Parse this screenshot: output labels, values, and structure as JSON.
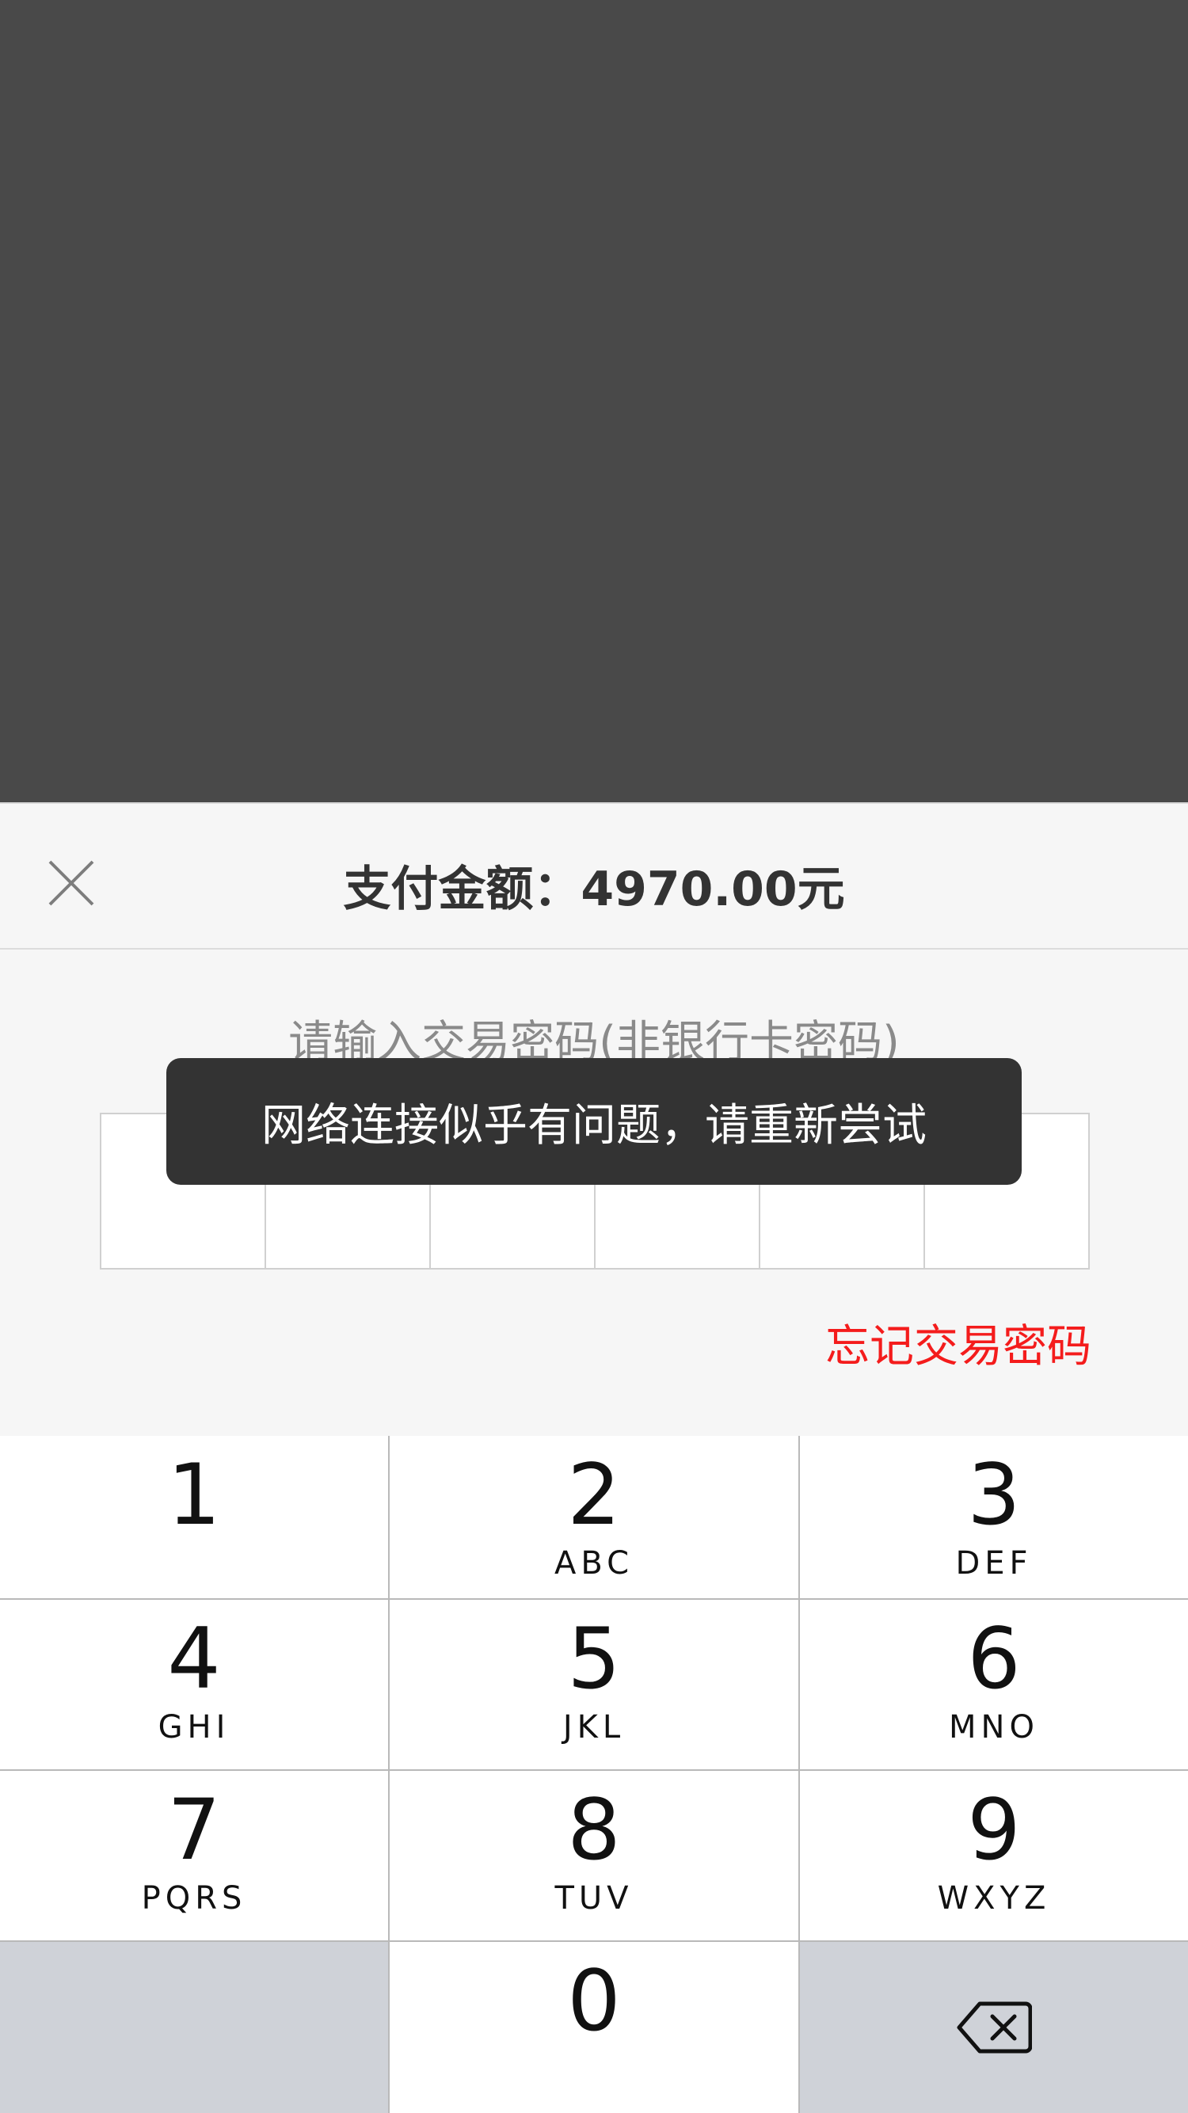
{
  "payment": {
    "amount_label": "支付金额：",
    "amount_value": "4970.00元",
    "prompt": "请输入交易密码(非银行卡密码)",
    "forgot_password": "忘记交易密码",
    "pin_length": 6
  },
  "toast": {
    "message": "网络连接似乎有问题，请重新尝试"
  },
  "keypad": {
    "keys": [
      {
        "digit": "1",
        "letters": ""
      },
      {
        "digit": "2",
        "letters": "ABC"
      },
      {
        "digit": "3",
        "letters": "DEF"
      },
      {
        "digit": "4",
        "letters": "GHI"
      },
      {
        "digit": "5",
        "letters": "JKL"
      },
      {
        "digit": "6",
        "letters": "MNO"
      },
      {
        "digit": "7",
        "letters": "PQRS"
      },
      {
        "digit": "8",
        "letters": "TUV"
      },
      {
        "digit": "9",
        "letters": "WXYZ"
      },
      {
        "digit": "0",
        "letters": ""
      }
    ],
    "backspace_icon": "backspace-icon"
  },
  "colors": {
    "overlay": "#494949",
    "accent_red": "#f41c1c",
    "toast_bg": "#333333"
  }
}
